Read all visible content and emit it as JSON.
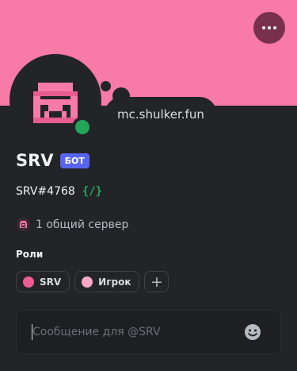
{
  "banner": {
    "color": "#f77aa7"
  },
  "custom_status": {
    "text": "mc.shulker.fun"
  },
  "profile": {
    "display_name": "SRV",
    "bot_badge": "БОТ",
    "tag": "SRV#4768",
    "slash_icon": "{/}",
    "status": "online",
    "status_color": "#23a55a"
  },
  "mutual": {
    "text": "1 общий сервер"
  },
  "roles": {
    "title": "Роли",
    "items": [
      {
        "label": "SRV",
        "color": "#f05c95"
      },
      {
        "label": "Игрок",
        "color": "#f7a8c9"
      }
    ],
    "add_label": "+"
  },
  "message": {
    "placeholder": "Сообщение для @SRV"
  },
  "icons": {
    "more": "more-dots-icon",
    "emoji": "smile-icon",
    "avatar": "shulker-icon"
  }
}
